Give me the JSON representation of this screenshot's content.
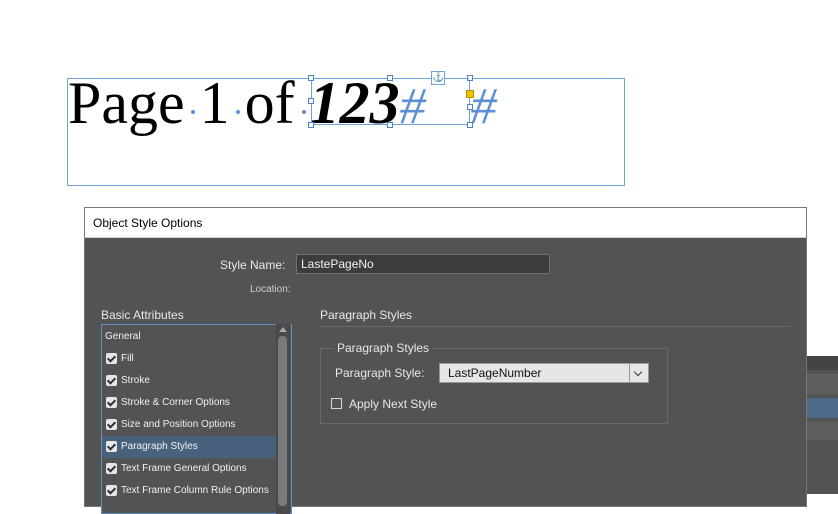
{
  "canvas": {
    "text_parts": [
      "Page",
      "1",
      "of",
      "123"
    ],
    "hash_marks": [
      "#",
      "#"
    ]
  },
  "dialog": {
    "title": "Object Style Options",
    "style_name_label": "Style Name:",
    "style_name_value": "LastePageNo",
    "location_label": "Location:",
    "basic_attributes_label": "Basic Attributes",
    "attributes": [
      {
        "label": "General",
        "checkbox": false,
        "selected": false
      },
      {
        "label": "Fill",
        "checkbox": true,
        "selected": false
      },
      {
        "label": "Stroke",
        "checkbox": true,
        "selected": false
      },
      {
        "label": "Stroke & Corner Options",
        "checkbox": true,
        "selected": false
      },
      {
        "label": "Size and Position Options",
        "checkbox": true,
        "selected": false
      },
      {
        "label": "Paragraph Styles",
        "checkbox": true,
        "selected": true
      },
      {
        "label": "Text Frame General Options",
        "checkbox": true,
        "selected": false
      },
      {
        "label": "Text Frame Column Rule Options",
        "checkbox": true,
        "selected": false
      }
    ],
    "section_title": "Paragraph Styles",
    "group_title": "Paragraph Styles",
    "paragraph_style_label": "Paragraph Style:",
    "paragraph_style_value": "LastPageNumber",
    "apply_next_style_label": "Apply Next Style",
    "apply_next_style_checked": false
  },
  "colors": {
    "frame_border": "#6fa3d4",
    "dialog_bg": "#535353",
    "selected_row": "#48617d",
    "hash_color": "#5b8fd6"
  },
  "icons": [
    "anchor-icon",
    "checkbox-checked-icon",
    "chevron-down-icon",
    "scroll-up-arrow-icon"
  ]
}
